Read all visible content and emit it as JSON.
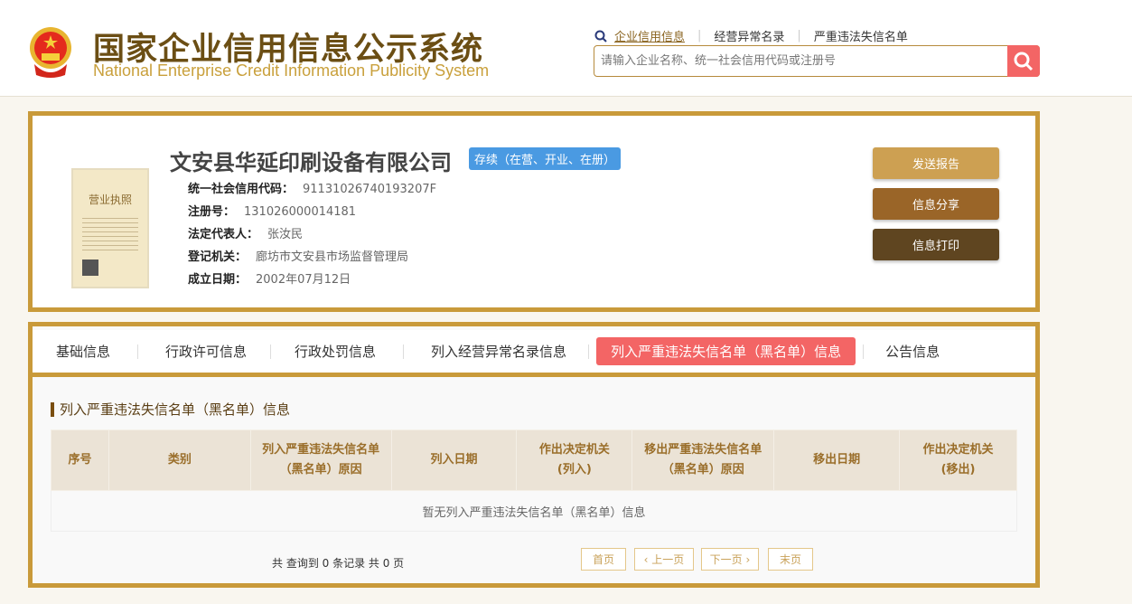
{
  "header": {
    "title_cn": "国家企业信用信息公示系统",
    "title_en": "National Enterprise Credit Information Publicity System",
    "links": [
      "企业信用信息",
      "经营异常名录",
      "严重违法失信名单"
    ],
    "search_placeholder": "请输入企业名称、统一社会信用代码或注册号"
  },
  "company": {
    "name": "文安县华延印刷设备有限公司",
    "status": "存续（在营、开业、在册）",
    "fields": [
      {
        "label": "统一社会信用代码：",
        "value": "91131026740193207F"
      },
      {
        "label": "注册号：",
        "value": "131026000014181"
      },
      {
        "label": "法定代表人：",
        "value": "张汝民"
      },
      {
        "label": "登记机关：",
        "value": "廊坊市文安县市场监督管理局"
      },
      {
        "label": "成立日期：",
        "value": "2002年07月12日"
      }
    ],
    "license_title": "营业执照",
    "actions": [
      "发送报告",
      "信息分享",
      "信息打印"
    ],
    "action_colors": [
      "#cda052",
      "#9a6528",
      "#5f4520"
    ]
  },
  "tabs": [
    "基础信息",
    "行政许可信息",
    "行政处罚信息",
    "列入经营异常名录信息",
    "列入严重违法失信名单（黑名单）信息",
    "公告信息"
  ],
  "section": {
    "title": "列入严重违法失信名单（黑名单）信息",
    "columns": [
      "序号",
      "类别",
      "列入严重违法失信名单（黑名单）原因",
      "列入日期",
      "作出决定机关(列入)",
      "移出严重违法失信名单（黑名单）原因",
      "移出日期",
      "作出决定机关(移出)"
    ],
    "empty": "暂无列入严重违法失信名单（黑名单）信息"
  },
  "pager": {
    "info": "共 查询到 0 条记录 共 0 页",
    "first": "首页",
    "prev": "上一页",
    "next": "下一页",
    "last": "末页"
  }
}
